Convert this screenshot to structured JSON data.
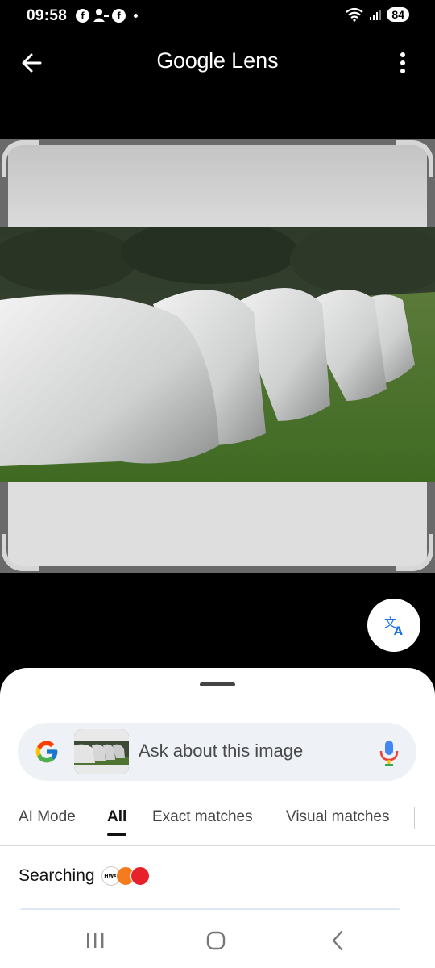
{
  "status_bar": {
    "time": "09:58",
    "battery": "84"
  },
  "header": {
    "title_google": "Google",
    "title_lens": "Lens"
  },
  "sheet": {
    "search_placeholder": "Ask about this image",
    "tabs": [
      {
        "label": "AI Mode"
      },
      {
        "label": "All"
      },
      {
        "label": "Exact matches"
      },
      {
        "label": "Visual matches"
      }
    ],
    "searching": "Searching",
    "favicon_label": "HWA"
  },
  "colors": {
    "accent": "#1a73e8",
    "sheet_bg": "#ffffff",
    "search_bg": "#eef2f6"
  }
}
